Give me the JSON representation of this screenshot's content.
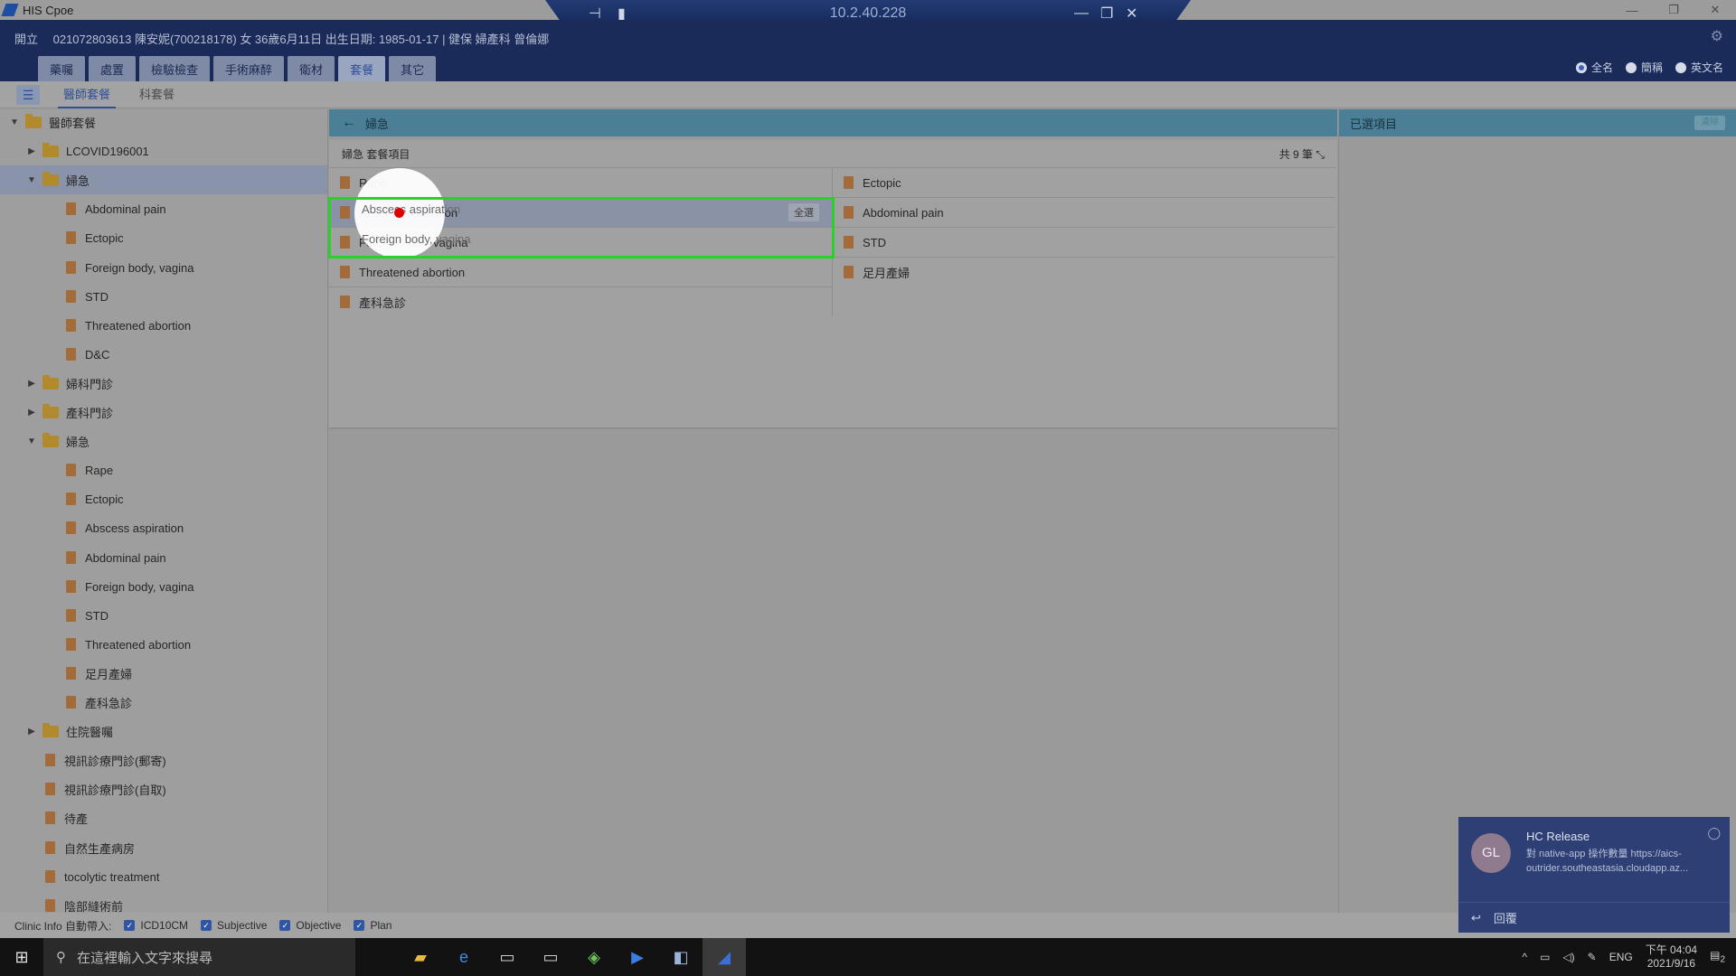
{
  "window": {
    "title": "HIS Cpoe",
    "rdp_ip": "10.2.40.228"
  },
  "patient_header": {
    "text": "開立　 021072803613 陳安妮(700218178) 女 36歲6月11日 出生日期: 1985-01-17 | 健保 婦產科 曾倫娜"
  },
  "order_tabs": [
    "藥囑",
    "處置",
    "檢驗檢查",
    "手術麻醉",
    "衛材",
    "套餐",
    "其它"
  ],
  "active_order_tab": "套餐",
  "name_mode": {
    "options": [
      "全名",
      "簡稱",
      "英文名"
    ],
    "selected": "全名"
  },
  "subtabs": [
    "醫師套餐",
    "科套餐"
  ],
  "active_subtab": "醫師套餐",
  "tree": {
    "root": "醫師套餐",
    "rows": [
      {
        "level": 0,
        "type": "folder",
        "expanded": true,
        "label": "醫師套餐"
      },
      {
        "level": 1,
        "type": "folder",
        "expanded": false,
        "label": "LCOVID196001"
      },
      {
        "level": 1,
        "type": "folder",
        "expanded": true,
        "label": "婦急",
        "selected": true
      },
      {
        "level": 2,
        "type": "doc",
        "label": "Abdominal pain"
      },
      {
        "level": 2,
        "type": "doc",
        "label": "Ectopic"
      },
      {
        "level": 2,
        "type": "doc",
        "label": "Foreign body, vagina"
      },
      {
        "level": 2,
        "type": "doc",
        "label": "STD"
      },
      {
        "level": 2,
        "type": "doc",
        "label": "Threatened abortion"
      },
      {
        "level": 2,
        "type": "doc",
        "label": "D&C"
      },
      {
        "level": 1,
        "type": "folder",
        "expanded": false,
        "label": "婦科門診"
      },
      {
        "level": 1,
        "type": "folder",
        "expanded": false,
        "label": "產科門診"
      },
      {
        "level": 1,
        "type": "folder",
        "expanded": true,
        "label": "婦急"
      },
      {
        "level": 2,
        "type": "doc",
        "label": "Rape"
      },
      {
        "level": 2,
        "type": "doc",
        "label": "Ectopic"
      },
      {
        "level": 2,
        "type": "doc",
        "label": "Abscess aspiration"
      },
      {
        "level": 2,
        "type": "doc",
        "label": "Abdominal pain"
      },
      {
        "level": 2,
        "type": "doc",
        "label": "Foreign body, vagina"
      },
      {
        "level": 2,
        "type": "doc",
        "label": "STD"
      },
      {
        "level": 2,
        "type": "doc",
        "label": "Threatened abortion"
      },
      {
        "level": 2,
        "type": "doc",
        "label": "足月產婦"
      },
      {
        "level": 2,
        "type": "doc",
        "label": "產科急診"
      },
      {
        "level": 1,
        "type": "folder",
        "expanded": false,
        "label": "住院醫囑"
      },
      {
        "level": 1,
        "type": "doc",
        "label": "視訊診療門診(郵寄)"
      },
      {
        "level": 1,
        "type": "doc",
        "label": "視訊診療門診(自取)"
      },
      {
        "level": 1,
        "type": "doc",
        "label": "待產"
      },
      {
        "level": 1,
        "type": "doc",
        "label": "自然生產病房"
      },
      {
        "level": 1,
        "type": "doc",
        "label": "tocolytic treatment"
      },
      {
        "level": 1,
        "type": "doc",
        "label": "陰部縫術前"
      }
    ]
  },
  "center": {
    "header_title": "婦急",
    "list_title": "婦急 套餐項目",
    "count_label": "共 9 筆",
    "all_label": "全選",
    "items": [
      "Rape",
      "Ectopic",
      "Abscess aspiration",
      "Abdominal pain",
      "Foreign body, vagina",
      "STD",
      "Threatened abortion",
      "足月產婦",
      "產科急診"
    ],
    "highlighted_item": "Abscess aspiration"
  },
  "right_panel": {
    "title": "已選項目",
    "button": "清除"
  },
  "statusbar": {
    "label": "Clinic Info 自動帶入:",
    "checkboxes": [
      "ICD10CM",
      "Subjective",
      "Objective",
      "Plan"
    ]
  },
  "taskbar": {
    "search_placeholder": "在這裡輸入文字來搜尋",
    "tray_lang": "ENG",
    "time": "下午 04:04",
    "date": "2021/9/16",
    "notification_count": "2"
  },
  "toast": {
    "avatar": "GL",
    "title": "HC Release",
    "body": "對 native-app 操作數量 https://aics-outrider.southeastasia.cloudapp.az...",
    "reply": "回覆"
  },
  "colors": {
    "header_bg": "#1a2b5a",
    "panel_header": "#4a7f96",
    "highlight_box": "#28d228",
    "click_dot": "#e00000"
  }
}
